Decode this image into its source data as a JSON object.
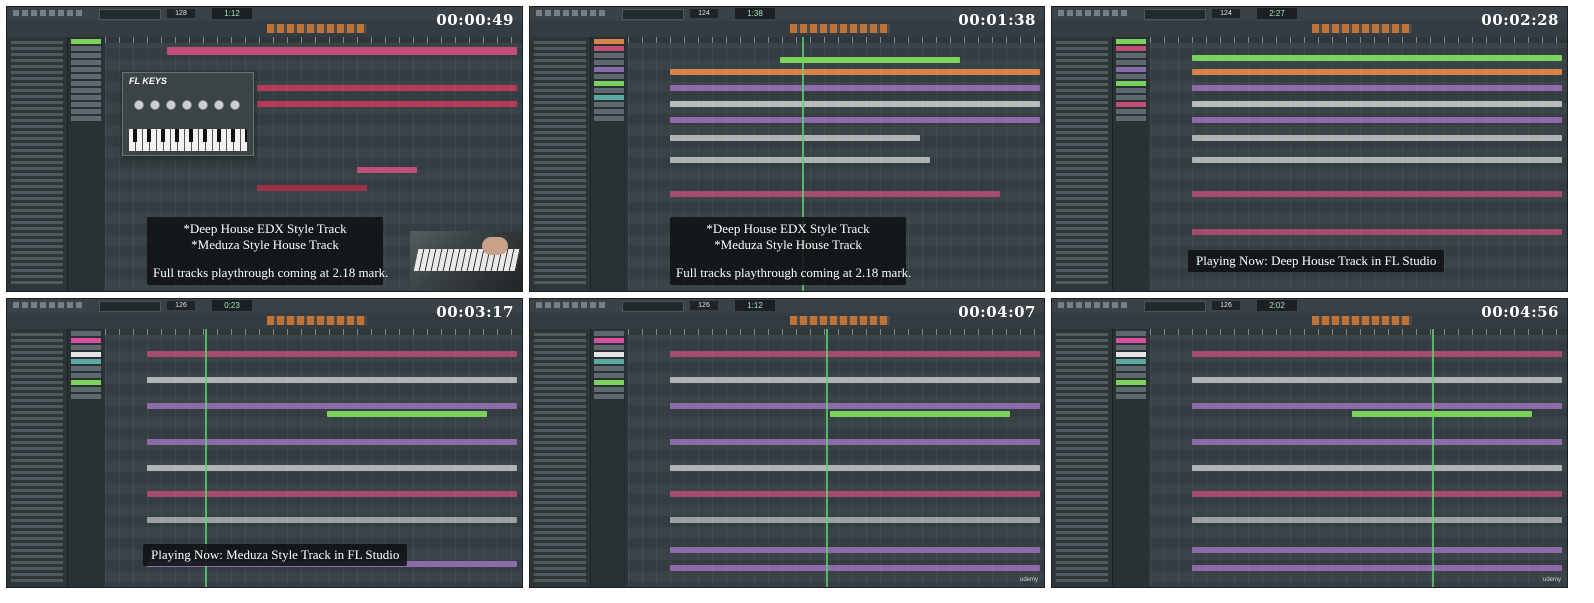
{
  "tiles": [
    {
      "timestamp": "00:00:49",
      "tempo": "128",
      "time_display": "1:12",
      "plugin_title": "FL KEYS",
      "overlay": {
        "line1": "*Deep House EDX Style Track",
        "line2": "*Meduza Style House Track",
        "line3": "Full tracks playthrough coming at 2.18 mark."
      }
    },
    {
      "timestamp": "00:01:38",
      "tempo": "124",
      "time_display": "1:38",
      "overlay": {
        "line1": "*Deep House EDX Style Track",
        "line2": "*Meduza Style House Track",
        "line3": "Full tracks playthrough coming at 2.18 mark."
      }
    },
    {
      "timestamp": "00:02:28",
      "tempo": "124",
      "time_display": "2:27",
      "playing_now": "Playing Now: Deep House Track in FL Studio"
    },
    {
      "timestamp": "00:03:17",
      "tempo": "126",
      "time_display": "0:23",
      "playing_now": "Playing Now: Meduza Style Track in FL Studio"
    },
    {
      "timestamp": "00:04:07",
      "tempo": "126",
      "time_display": "1:12",
      "playing_now": ""
    },
    {
      "timestamp": "00:04:56",
      "tempo": "126",
      "time_display": "2:02",
      "playing_now": ""
    }
  ],
  "colors": {
    "clip_green": "#7bd35c",
    "clip_pink": "#c24f78",
    "clip_purple": "#8d6aa8",
    "clip_orange": "#d9824a",
    "clip_white": "#e4e4e4",
    "clip_teal": "#5aa9a3",
    "playhead": "#5fd36b"
  }
}
